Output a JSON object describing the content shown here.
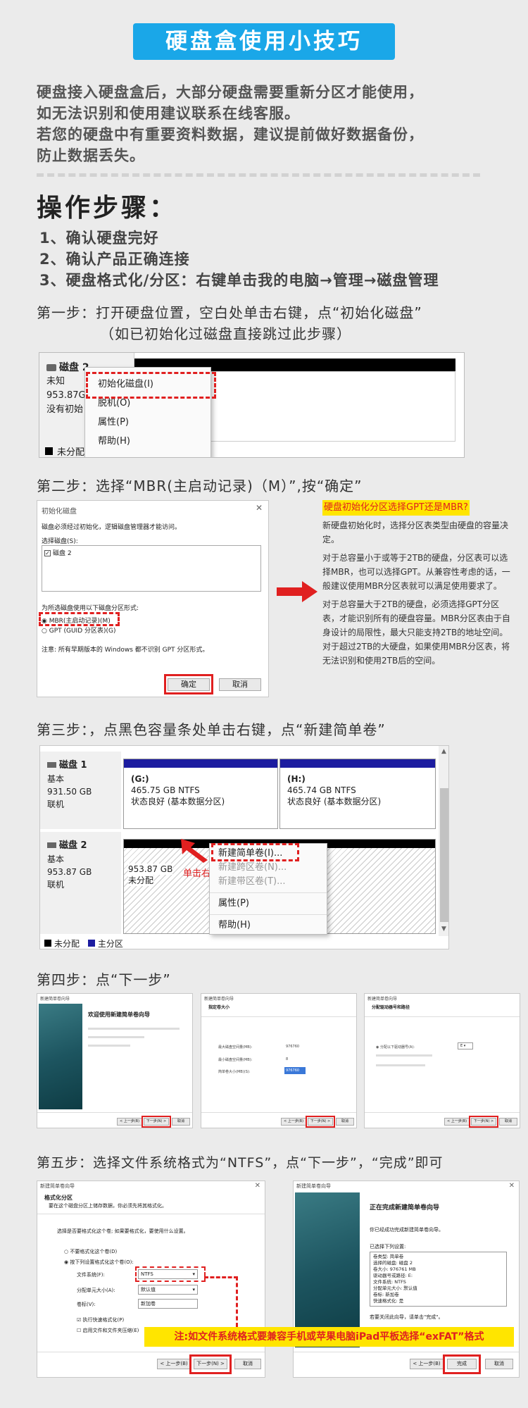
{
  "title": "硬盘盒使用小技巧",
  "intro": [
    "硬盘接入硬盘盒后，大部分硬盘需要重新分区才能使用，",
    "如无法识别和使用建议联系在线客服。",
    "若您的硬盘中有重要资料数据，建议提前做好数据备份，",
    "防止数据丢失。"
  ],
  "steps_title": "操作步骤：",
  "steps_list": [
    "1、确认硬盘完好",
    "2、确认产品正确连接",
    "3、硬盘格式化/分区：右键单击我的电脑→管理→磁盘管理"
  ],
  "step1": {
    "head": "第一步：打开硬盘位置，空白处单击右键，点“初始化磁盘”",
    "sub": "（如已初始化过磁盘直接跳过此步骤）",
    "disk_label": "磁盘 2",
    "disk_lines": [
      "未知",
      "953.87G",
      "没有初始"
    ],
    "menu": [
      "初始化磁盘(I)",
      "脱机(O)",
      "属性(P)",
      "帮助(H)"
    ],
    "legend": "未分配"
  },
  "step2": {
    "head": "第二步：选择“MBR(主启动记录)（M）”,按“确定”",
    "dialog_title": "初始化磁盘",
    "dialog_desc": "磁盘必须经过初始化，逻辑磁盘管理器才能访问。",
    "select_label": "选择磁盘(S):",
    "disk_item": "磁盘 2",
    "style_label": "为所选磁盘使用以下磁盘分区形式:",
    "opt_mbr": "MBR(主启动记录)(M)",
    "opt_gpt": "GPT (GUID 分区表)(G)",
    "note": "注意: 所有早期版本的 Windows 都不识别 GPT 分区形式。",
    "ok": "确定",
    "cancel": "取消",
    "q_title": "硬盘初始化分区选择GPT还是MBR?",
    "p1": "新硬盘初始化时，选择分区表类型由硬盘的容量决定。",
    "p2": "对于总容量小于或等于2TB的硬盘，分区表可以选择MBR，也可以选择GPT。从兼容性考虑的话，一般建议使用MBR分区表就可以满足使用要求了。",
    "p3": "对于总容量大于2TB的硬盘，必须选择GPT分区表，才能识别所有的硬盘容量。MBR分区表由于自身设计的局限性，最大只能支持2TB的地址空间。对于超过2TB的大硬盘，如果使用MBR分区表，将无法识别和使用2TB后的空间。"
  },
  "step3": {
    "head": "第三步：，点黑色容量条处单击右键，点“新建简单卷”",
    "disk1": {
      "name": "磁盘 1",
      "type": "基本",
      "size": "931.50 GB",
      "status": "联机"
    },
    "part_g": {
      "label": "(G:)",
      "size": "465.75 GB NTFS",
      "status": "状态良好 (基本数据分区)"
    },
    "part_h": {
      "label": "(H:)",
      "size": "465.74 GB NTFS",
      "status": "状态良好 (基本数据分区)"
    },
    "disk2": {
      "name": "磁盘 2",
      "type": "基本",
      "size": "953.87 GB",
      "status": "联机"
    },
    "unalloc_size": "953.87 GB",
    "unalloc_label": "未分配",
    "right_click": "单击右键",
    "menu": [
      "新建简单卷(I)...",
      "新建跨区卷(N)...",
      "新建带区卷(T)...",
      "属性(P)",
      "帮助(H)"
    ],
    "legend_unalloc": "未分配",
    "legend_primary": "主分区"
  },
  "step4": {
    "head": "第四步：点“下一步”",
    "wiz_title": "新建简单卷向导",
    "welcome": "欢迎使用新建简单卷向导",
    "size_title": "指定卷大小",
    "assign_title": "分配驱动器号和路径",
    "max_label": "最大磁盘空间量(MB):",
    "max_val": "976760",
    "min_label": "最小磁盘空间量(MB):",
    "min_val": "8",
    "vol_label": "简单卷大小(MB)(S):",
    "vol_val": "976760",
    "assign_opt": "分配以下驱动器号(A):",
    "drive": "E",
    "back": "< 上一步(B)",
    "next": "下一步(N) >",
    "cancel": "取消"
  },
  "step5": {
    "head": "第五步：选择文件系统格式为“NTFS”，点“下一步”，“完成”即可",
    "fmt_title": "格式化分区",
    "fmt_desc": "要在这个磁盘分区上储存数据，你必须先将其格式化。",
    "fmt_choose": "选择是否要格式化这个卷; 如果要格式化，要使用什么设置。",
    "no_fmt": "不要格式化这个卷(D)",
    "do_fmt": "按下列设置格式化这个卷(O):",
    "fs_label": "文件系统(F):",
    "fs_val": "NTFS",
    "unit_label": "分配单元大小(A):",
    "unit_val": "默认值",
    "vol_label": "卷标(V):",
    "vol_val": "新加卷",
    "quick": "执行快速格式化(P)",
    "compress": "启用文件和文件夹压缩(E)",
    "done_title": "正在完成新建简单卷向导",
    "done_desc": "你已经成功完成新建简单卷向导。",
    "done_sel": "已选择下列设置:",
    "summary": [
      "卷类型: 简单卷",
      "选择的磁盘: 磁盘 2",
      "卷大小: 976761 MB",
      "驱动器号或路径: E:",
      "文件系统: NTFS",
      "分配单元大小: 默认值",
      "卷标: 新加卷",
      "快速格式化: 是"
    ],
    "close_hint": "若要关闭此向导，请单击\"完成\"。",
    "note": "注:如文件系统格式要兼容手机或苹果电脑iPad平板选择“exFAT”格式",
    "back": "< 上一步(B)",
    "next": "下一步(N) >",
    "finish": "完成",
    "cancel": "取消"
  },
  "colors": {
    "title_bg": "#1aa7e8",
    "accent_red": "#e02020",
    "note_yellow": "#ffe500",
    "disk_black": "#000000",
    "primary_blue": "#1c1ca0"
  }
}
